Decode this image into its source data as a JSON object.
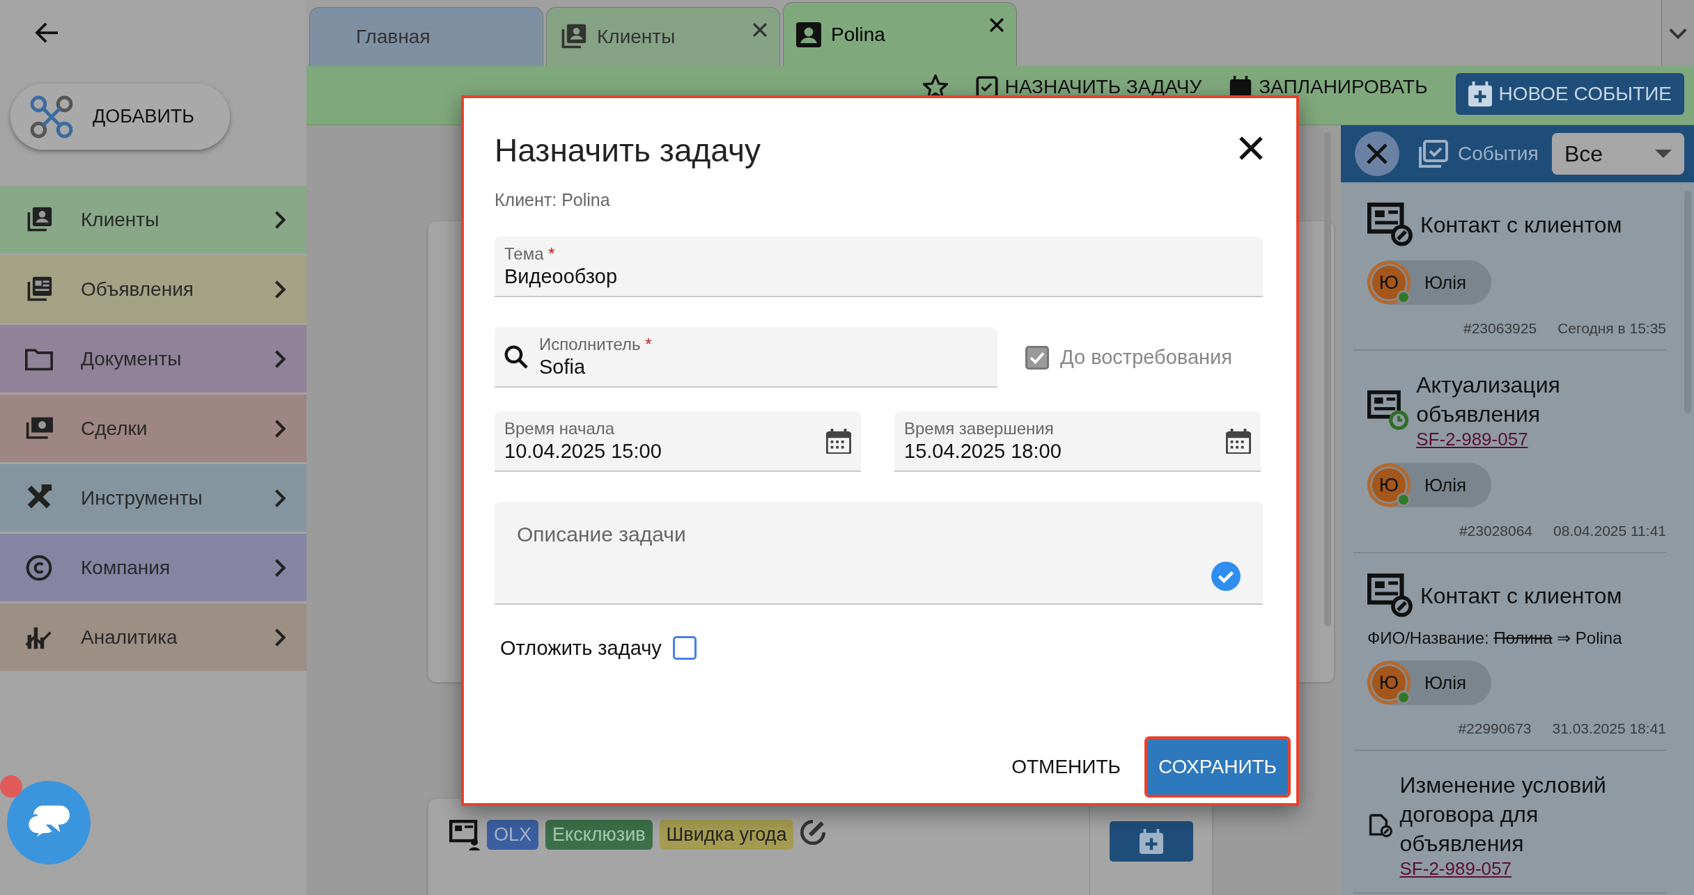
{
  "sidebar": {
    "add_button": "ДОБАВИТЬ",
    "items": [
      {
        "label": "Клиенты",
        "kind": "clients",
        "color": "#88a888"
      },
      {
        "label": "Объявления",
        "kind": "listings",
        "color": "#a3a284"
      },
      {
        "label": "Документы",
        "kind": "documents",
        "color": "#8f8299"
      },
      {
        "label": "Сделки",
        "kind": "deals",
        "color": "#9e8684"
      },
      {
        "label": "Инструменты",
        "kind": "tools",
        "color": "#8595a0"
      },
      {
        "label": "Компания",
        "kind": "company",
        "color": "#8584a3"
      },
      {
        "label": "Аналитика",
        "kind": "analytics",
        "color": "#9c8f84"
      }
    ]
  },
  "tabs": [
    {
      "label": "Главная",
      "selected": false,
      "closable": false,
      "kind": "home"
    },
    {
      "label": "Клиенты",
      "selected": false,
      "closable": true,
      "kind": "clients"
    },
    {
      "label": "Polina",
      "selected": true,
      "closable": true,
      "kind": "person"
    }
  ],
  "toolbar": {
    "actions": [
      "НАЗНАЧИТЬ ЗАДАЧУ",
      "ЗАПЛАНИРОВАТЬ"
    ],
    "primary_action": "НОВОЕ СОБЫТИЕ"
  },
  "main": {
    "listing": {
      "tags": [
        {
          "label": "OLX",
          "color": "#3b5fa0"
        },
        {
          "label": "Ексклюзив",
          "color": "#3c7049"
        },
        {
          "label": "Швидка угода",
          "color": "#a59b50"
        }
      ]
    }
  },
  "events_panel": {
    "title": "События",
    "filter": "Все",
    "events": [
      {
        "kind": "contact",
        "title": "Контакт с клиентом",
        "user_initial": "Ю",
        "user": "Юлія",
        "id": "#23063925",
        "date": "Сегодня в 15:35"
      },
      {
        "kind": "reminder",
        "title": "Актуализация объявления",
        "link": "SF-2-989-057",
        "user_initial": "Ю",
        "user": "Юлія",
        "id": "#23028064",
        "date": "08.04.2025 11:41"
      },
      {
        "kind": "contact",
        "title": "Контакт с клиентом",
        "change": {
          "label": "ФИО/Название:",
          "old": "Полина",
          "arrow": "⇒",
          "new": "Polina"
        },
        "user_initial": "Ю",
        "user": "Юлія",
        "id": "#22990673",
        "date": "31.03.2025 18:41"
      },
      {
        "kind": "document",
        "title": "Изменение условий договора для объявления",
        "link": "SF-2-989-057"
      }
    ]
  },
  "dialog": {
    "title": "Назначить задачу",
    "highlighted": true,
    "client": "Клиент: Polina",
    "subject": {
      "label": "Тема",
      "required_mark": "*",
      "value": "Видеообзор"
    },
    "assignee": {
      "label": "Исполнитель",
      "required_mark": "*",
      "value": "Sofia"
    },
    "on_demand": {
      "label": "До востребования",
      "checked": true,
      "disabled": true
    },
    "start": {
      "label": "Время начала",
      "value": "10.04.2025 15:00"
    },
    "end": {
      "label": "Время завершения",
      "value": "15.04.2025 18:00"
    },
    "description": {
      "placeholder": "Описание задачи"
    },
    "postpone": {
      "label": "Отложить задачу",
      "checked": false
    },
    "buttons": [
      {
        "label": "ОТМЕНИТЬ",
        "kind": "text",
        "highlighted": false
      },
      {
        "label": "СОХРАНИТЬ",
        "kind": "primary",
        "highlighted": true
      }
    ]
  },
  "chat": {
    "unread": true
  }
}
